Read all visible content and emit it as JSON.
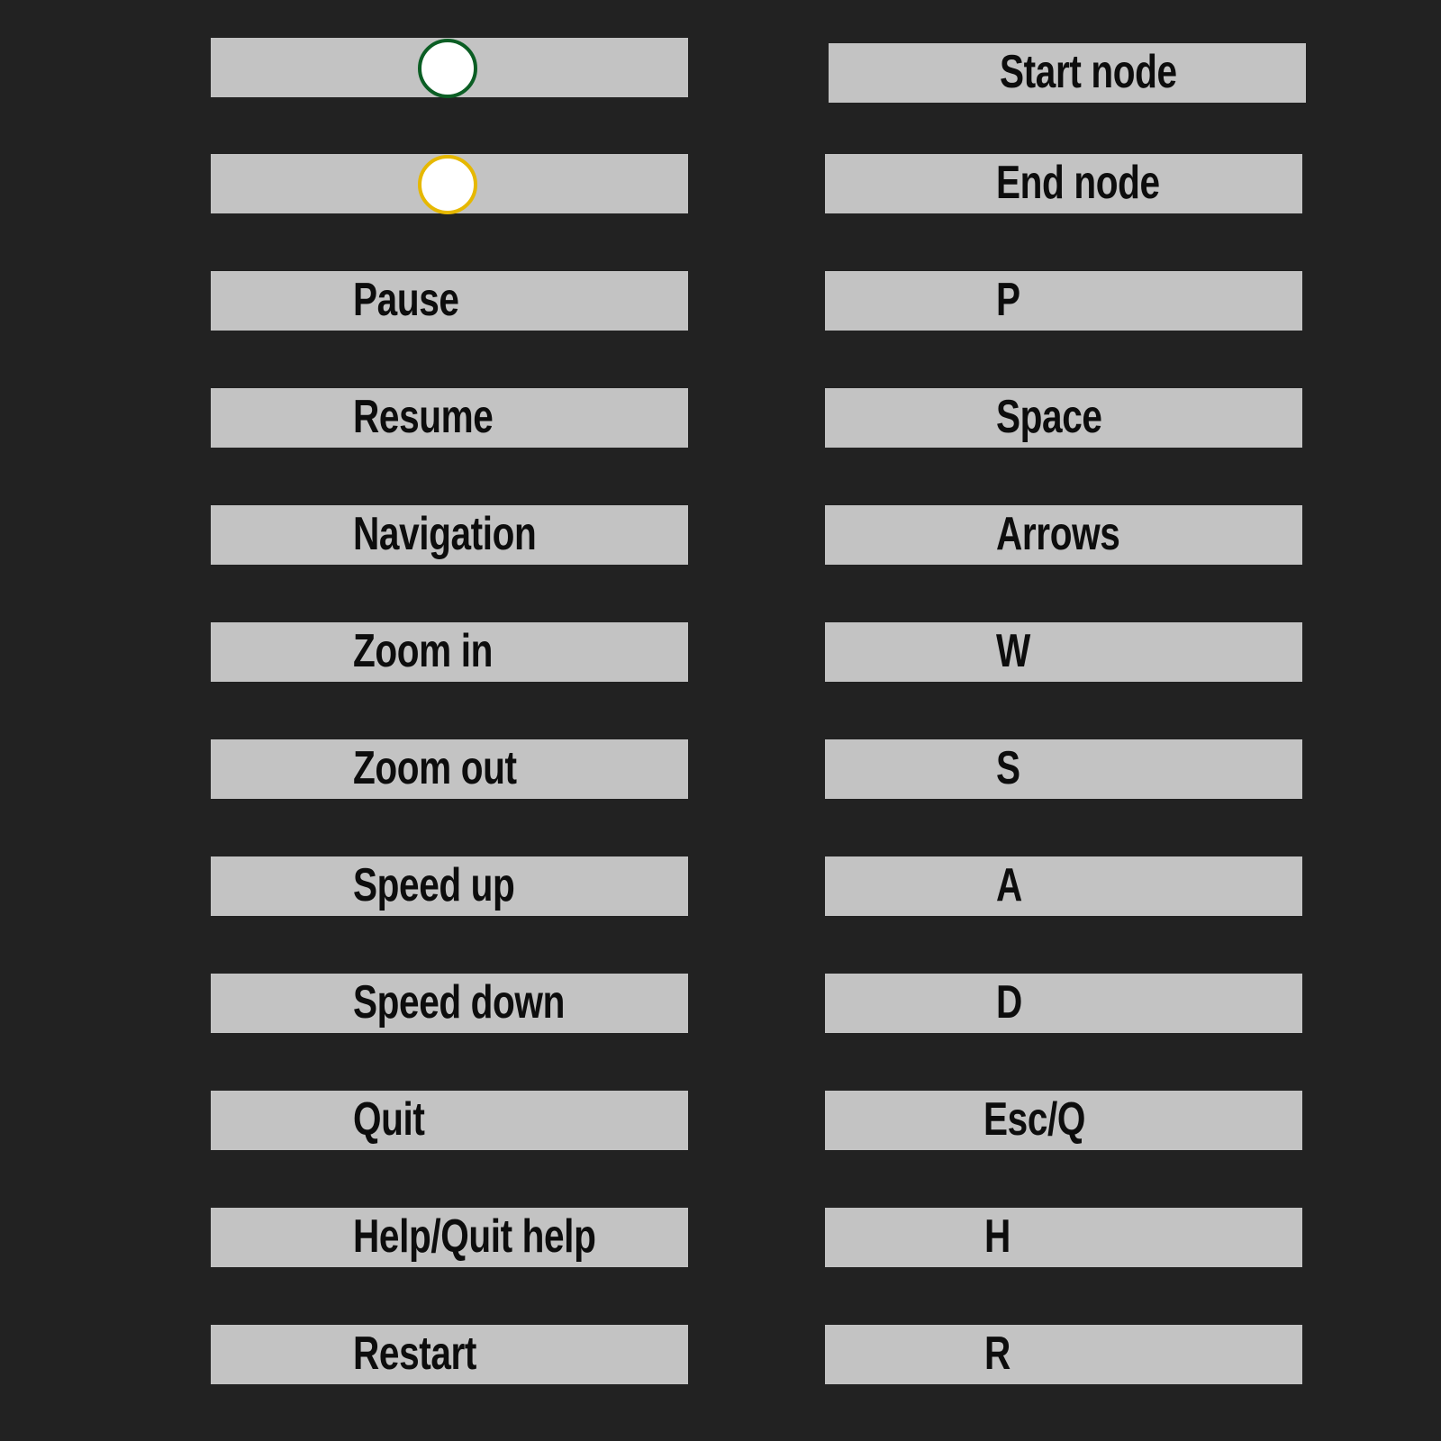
{
  "colors": {
    "background": "#222222",
    "bar": "#c3c3c3",
    "text": "#0d0d0d",
    "start_node_border": "#0b5e24",
    "end_node_border": "#e6b800"
  },
  "rows": [
    {
      "action_icon": "start-node-circle-icon",
      "key": "Start node"
    },
    {
      "action_icon": "end-node-circle-icon",
      "key": "End node"
    },
    {
      "action": "Pause",
      "key": "P"
    },
    {
      "action": "Resume",
      "key": "Space"
    },
    {
      "action": "Navigation",
      "key": "Arrows"
    },
    {
      "action": "Zoom in",
      "key": "W"
    },
    {
      "action": "Zoom out",
      "key": "S"
    },
    {
      "action": "Speed up",
      "key": "A"
    },
    {
      "action": "Speed down",
      "key": "D"
    },
    {
      "action": "Quit",
      "key": "Esc/Q"
    },
    {
      "action": "Help/Quit help",
      "key": "H"
    },
    {
      "action": "Restart",
      "key": "R"
    }
  ]
}
